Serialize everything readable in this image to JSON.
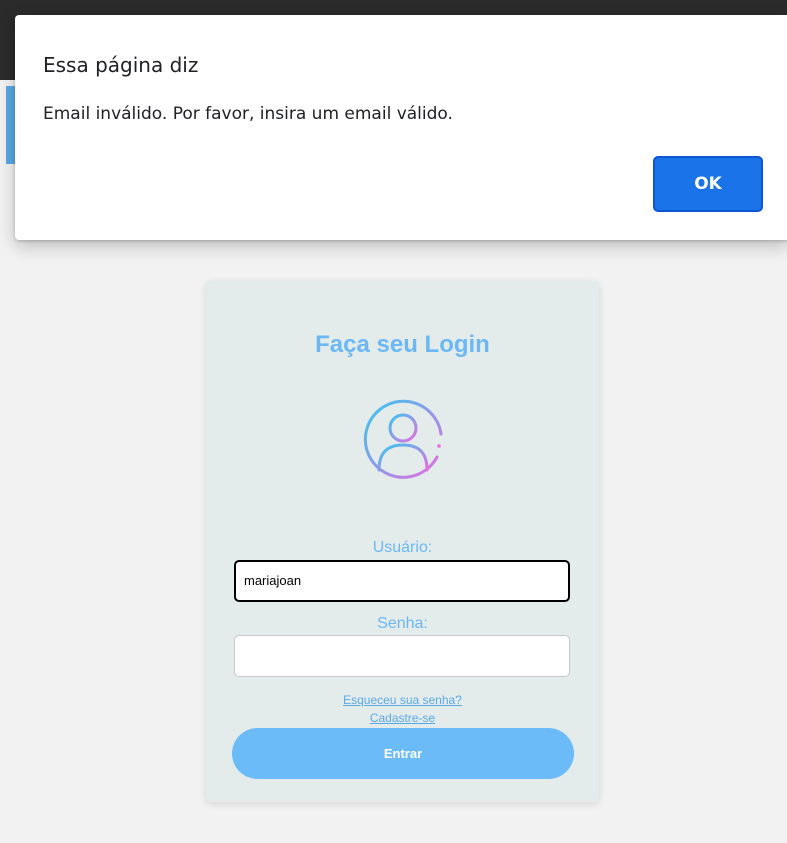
{
  "dialog": {
    "title": "Essa página diz",
    "message": "Email inválido. Por favor, insira um email válido.",
    "ok_label": "OK"
  },
  "login": {
    "title": "Faça seu Login",
    "avatar_icon": "user-circle-icon",
    "username_label": "Usuário:",
    "username_value": "mariajoan",
    "password_label": "Senha:",
    "password_value": "",
    "forgot_link": "Esqueceu sua senha?",
    "signup_link": "Cadastre-se",
    "submit_label": "Entrar"
  },
  "colors": {
    "accent": "#6bb8f5",
    "dialog_button": "#1a73e8",
    "card_background": "#e3ebeb"
  }
}
